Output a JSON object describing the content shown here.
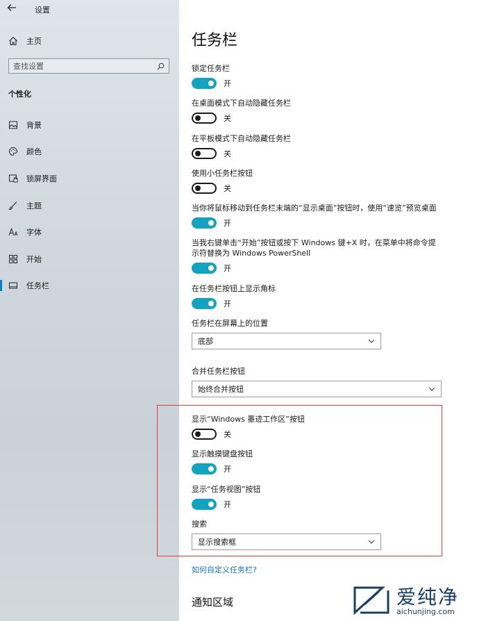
{
  "window": {
    "title": "设置"
  },
  "sidebar": {
    "home_label": "主页",
    "search_placeholder": "查找设置",
    "section_label": "个性化",
    "items": [
      {
        "label": "背景",
        "icon": "image-icon"
      },
      {
        "label": "颜色",
        "icon": "palette-icon"
      },
      {
        "label": "锁屏界面",
        "icon": "lock-screen-icon"
      },
      {
        "label": "主题",
        "icon": "brush-icon"
      },
      {
        "label": "字体",
        "icon": "font-icon"
      },
      {
        "label": "开始",
        "icon": "start-icon"
      },
      {
        "label": "任务栏",
        "icon": "taskbar-icon",
        "selected": true
      }
    ]
  },
  "main": {
    "title": "任务栏",
    "settings": [
      {
        "label": "锁定任务栏",
        "state": "开",
        "on": true
      },
      {
        "label": "在桌面模式下自动隐藏任务栏",
        "state": "关",
        "on": false
      },
      {
        "label": "在平板模式下自动隐藏任务栏",
        "state": "关",
        "on": false
      },
      {
        "label": "使用小任务栏按钮",
        "state": "关",
        "on": false
      },
      {
        "label": "当你将鼠标移动到任务栏末端的“显示桌面”按钮时，使用“速览”预览桌面",
        "state": "开",
        "on": true
      },
      {
        "label": "当我右键单击“开始”按钮或按下 Windows 键+X 时，在菜单中将命令提示符替换为 Windows PowerShell",
        "state": "开",
        "on": true
      },
      {
        "label": "在任务栏按钮上显示角标",
        "state": "开",
        "on": true
      }
    ],
    "position": {
      "label": "任务栏在屏幕上的位置",
      "value": "底部"
    },
    "combine": {
      "label": "合并任务栏按钮",
      "value": "始终合并按钮"
    },
    "highlighted": [
      {
        "label": "显示“Windows 墨迹工作区”按钮",
        "state": "关",
        "on": false
      },
      {
        "label": "显示触摸键盘按钮",
        "state": "开",
        "on": true
      },
      {
        "label": "显示“任务视图”按钮",
        "state": "开",
        "on": true
      }
    ],
    "search": {
      "label": "搜索",
      "value": "显示搜索框"
    },
    "help_link": "如何自定义任务栏?",
    "notification_heading": "通知区域"
  },
  "watermark": {
    "text": "爱纯净",
    "url": "aichunjing.com"
  },
  "colors": {
    "accent": "#13a3bf",
    "link": "#1473c4",
    "highlight_box": "#e53935",
    "selected_bar": "#0a7bc7"
  }
}
